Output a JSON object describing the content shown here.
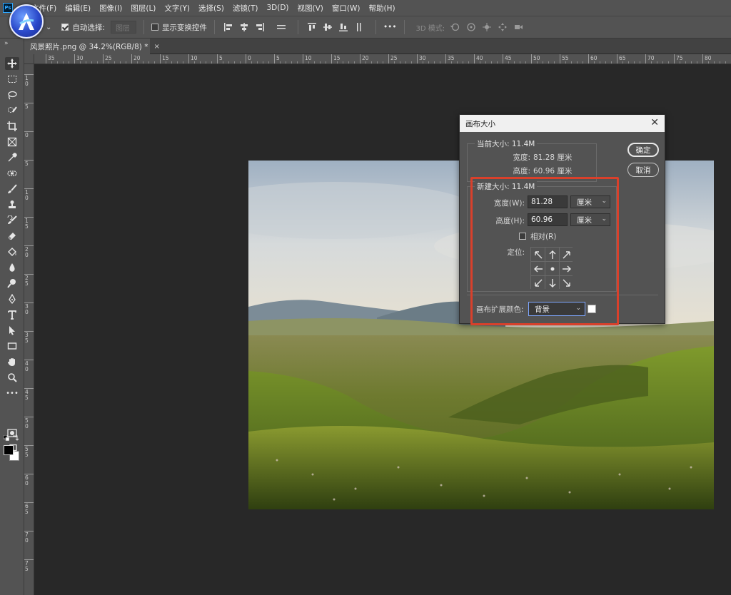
{
  "app": {
    "logo_text": "Ps",
    "menu": [
      "文件(F)",
      "编辑(E)",
      "图像(I)",
      "图层(L)",
      "文字(Y)",
      "选择(S)",
      "滤镜(T)",
      "3D(D)",
      "视图(V)",
      "窗口(W)",
      "帮助(H)"
    ]
  },
  "options_bar": {
    "auto_select_label": "自动选择:",
    "auto_select_checked": true,
    "layer_select_value": "图层",
    "show_transform_label": "显示变换控件",
    "show_transform_checked": false,
    "more_label": "•••",
    "mode3d_label": "3D 模式:"
  },
  "document_tab": {
    "title": "风景照片.png @ 34.2%(RGB/8) *",
    "close_label": "×"
  },
  "toolbar": {
    "collapse_label": "»",
    "more_label": "•••",
    "tools": [
      "move-tool",
      "marquee-tool",
      "lasso-tool",
      "quick-select-tool",
      "crop-tool",
      "frame-tool",
      "eyedropper-tool",
      "healing-brush-tool",
      "brush-tool",
      "clone-stamp-tool",
      "history-brush-tool",
      "eraser-tool",
      "paint-bucket-tool",
      "blur-tool",
      "dodge-tool",
      "pen-tool",
      "type-tool",
      "path-select-tool",
      "rectangle-tool",
      "hand-tool",
      "zoom-tool"
    ],
    "foreground_color": "#000000",
    "background_color": "#ffffff"
  },
  "ruler": {
    "horizontal_labels": [
      "35",
      "30",
      "25",
      "20",
      "15",
      "10",
      "5",
      "0",
      "5",
      "10",
      "15",
      "20",
      "25",
      "30",
      "35",
      "40",
      "45",
      "50",
      "55",
      "60",
      "65",
      "70",
      "75",
      "80"
    ],
    "vertical_labels": [
      "1\n0",
      "5",
      "0",
      "5",
      "1\n0",
      "1\n5",
      "2\n0",
      "2\n5",
      "3\n0",
      "3\n5",
      "4\n0",
      "4\n5",
      "5\n0",
      "5\n5",
      "6\n0",
      "6\n5",
      "7\n0",
      "7\n5"
    ]
  },
  "dialog": {
    "title": "画布大小",
    "close_label": "✕",
    "ok_label": "确定",
    "cancel_label": "取消",
    "current": {
      "legend": "当前大小: 11.4M",
      "width_label": "宽度:",
      "width_value": "81.28 厘米",
      "height_label": "高度:",
      "height_value": "60.96 厘米"
    },
    "new": {
      "legend": "新建大小: 11.4M",
      "width_label": "宽度(W):",
      "width_value": "81.28",
      "width_unit": "厘米",
      "height_label": "高度(H):",
      "height_value": "60.96",
      "height_unit": "厘米",
      "relative_label": "相对(R)",
      "relative_checked": false,
      "anchor_label": "定位:",
      "anchor_selected": "center"
    },
    "extension": {
      "label": "画布扩展颜色:",
      "value": "背景",
      "swatch_color": "#ffffff"
    }
  },
  "colors": {
    "highlight": "#d9402b",
    "panel": "#535353",
    "workspace": "#282828"
  }
}
